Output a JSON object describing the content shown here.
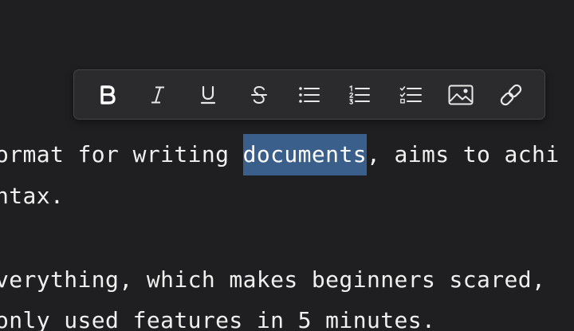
{
  "text": {
    "line1_before": "ormat for writing ",
    "line1_selected": "documents",
    "line1_after": ", aims to achi",
    "line2": "ntax.",
    "line3": "verything, which makes beginners scared,",
    "line4": "only used features in 5 minutes."
  },
  "toolbar": {
    "buttons": [
      {
        "name": "bold",
        "icon": "bold-icon"
      },
      {
        "name": "italic",
        "icon": "italic-icon"
      },
      {
        "name": "underline",
        "icon": "underline-icon"
      },
      {
        "name": "strikethrough",
        "icon": "strikethrough-icon"
      },
      {
        "name": "bullet-list",
        "icon": "bullet-list-icon"
      },
      {
        "name": "ordered-list",
        "icon": "ordered-list-icon"
      },
      {
        "name": "task-list",
        "icon": "task-list-icon"
      },
      {
        "name": "image",
        "icon": "image-icon"
      },
      {
        "name": "link",
        "icon": "link-icon"
      }
    ]
  },
  "colors": {
    "background": "#1f1e20",
    "toolbar": "#2b2b2d",
    "text": "#f0f0f0",
    "selection": "#3a5f8a"
  }
}
